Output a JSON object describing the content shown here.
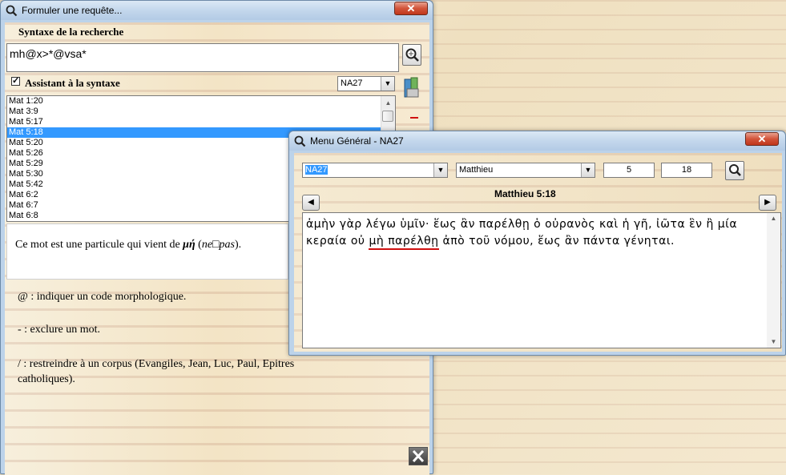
{
  "left_window": {
    "title": "Formuler une requête...",
    "close_label": "✕",
    "syntax_label": "Syntaxe de la recherche",
    "query_value": "mh@x>*@vsa*",
    "assistant_label": "Assistant à la syntaxe",
    "assistant_checked": "✓",
    "corpus_select": "NA27",
    "results": [
      "Mat 1:20",
      "Mat 3:9",
      "Mat 5:17",
      "Mat 5:18",
      "Mat 5:20",
      "Mat 5:26",
      "Mat 5:29",
      "Mat 5:30",
      "Mat 5:42",
      "Mat 6:2",
      "Mat 6:7",
      "Mat 6:8"
    ],
    "selected_result": "Mat 5:18",
    "description_prefix": "Ce mot est une particule qui vient de ",
    "description_word": "μή",
    "description_open": " (",
    "description_gloss": "ne□pas",
    "description_close": ").",
    "help_lines": [
      "@ : indiquer un code morphologique.",
      "- : exclure un mot.",
      "/ : restreindre à un corpus (Evangiles, Jean, Luc, Paul, Epitres catholiques)."
    ]
  },
  "right_window": {
    "title": "Menu Général - NA27",
    "close_label": "✕",
    "version_select": "NA27",
    "book_select": "Matthieu",
    "chapter": "5",
    "verse": "18",
    "reference": "Matthieu 5:18",
    "text_before": "ἀμὴν γὰρ λέγω ὑμῖν· ἕως ἂν παρέλθῃ ὁ οὐρανὸς καὶ ἡ γῆ, ἰῶτα ἓν ἢ μία κεραία οὐ ",
    "text_highlight": "μὴ παρέλθῃ",
    "text_after": " ἀπὸ τοῦ νόμου, ἕως ἂν πάντα γένηται."
  }
}
